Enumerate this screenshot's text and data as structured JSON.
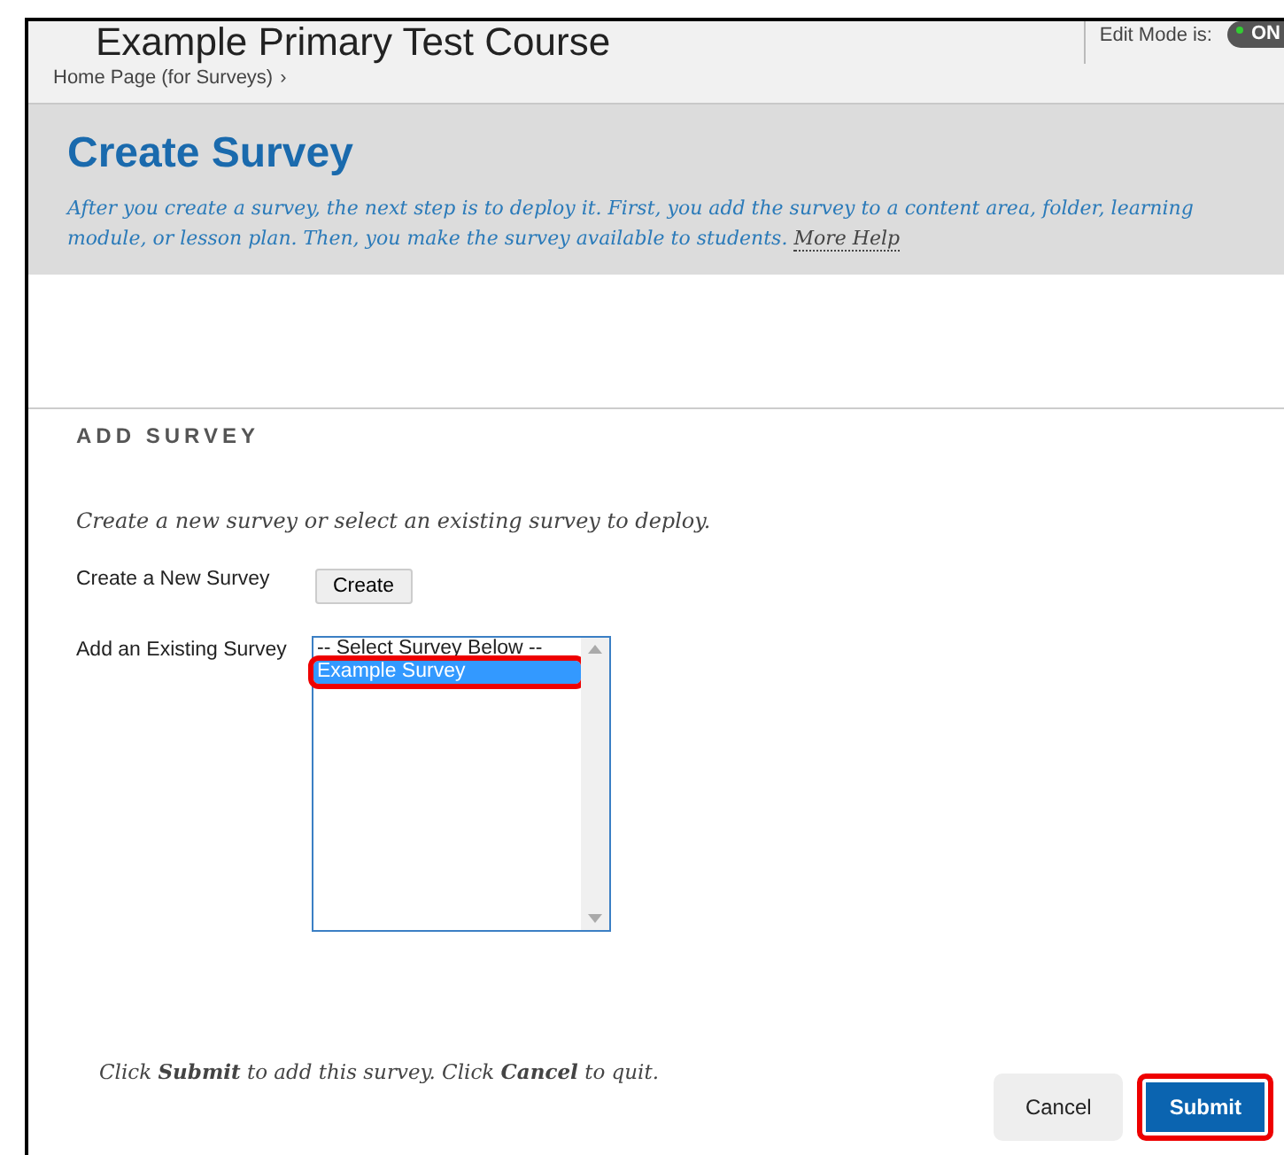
{
  "header": {
    "course_title": "Example Primary Test Course",
    "breadcrumb": "Home Page (for Surveys)",
    "breadcrumb_separator": "›",
    "edit_mode_label": "Edit Mode is:",
    "edit_mode_toggle": {
      "label": "ON",
      "on": true
    }
  },
  "page_title": "Create Survey",
  "intro": {
    "text": "After you create a survey, the next step is to deploy it. First, you add the survey to a content area, folder, learning module, or lesson plan. Then, you make the survey available to students.",
    "link": "More Help"
  },
  "section": {
    "heading": "ADD SURVEY",
    "instructions": "Create a new survey or select an existing survey to deploy.",
    "create_label": "Create a New Survey",
    "create_button": "Create",
    "existing_label": "Add an Existing Survey",
    "survey_list": [
      {
        "label": "-- Select Survey Below --",
        "selected": false,
        "highlighted": false
      },
      {
        "label": "Example Survey",
        "selected": true,
        "highlighted": true
      }
    ]
  },
  "footer": {
    "note": "Click **Submit** to add this survey. Click **Cancel** to quit.",
    "buttons": [
      {
        "label": "Cancel",
        "kind": "secondary",
        "highlighted": false
      },
      {
        "label": "Submit",
        "kind": "primary",
        "highlighted": true
      }
    ]
  }
}
